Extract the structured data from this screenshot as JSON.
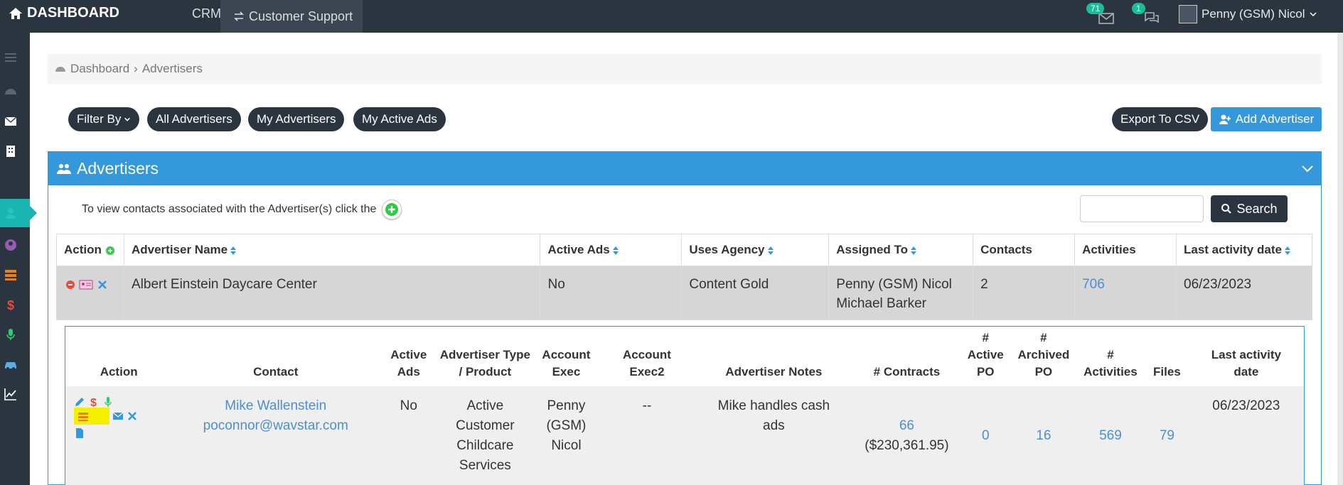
{
  "topbar": {
    "brand": "DASHBOARD",
    "nav_crm": "CRM",
    "nav_customer_support": "Customer Support",
    "mail_count": "71",
    "chat_count": "1",
    "user_name": "Penny (GSM) Nicol"
  },
  "breadcrumb": {
    "home": "Dashboard",
    "separator": "›",
    "current": "Advertisers"
  },
  "filters": {
    "filter_by": "Filter By",
    "all": "All Advertisers",
    "mine": "My Advertisers",
    "active_ads": "My Active Ads"
  },
  "actions": {
    "export": "Export To CSV",
    "add": "Add Advertiser"
  },
  "panel": {
    "title": "Advertisers",
    "hint": "To view contacts associated with the Advertiser(s) click the",
    "search_label": "Search"
  },
  "table": {
    "headers": {
      "action": "Action",
      "name": "Advertiser Name",
      "active_ads": "Active Ads",
      "uses_agency": "Uses Agency",
      "assigned": "Assigned To",
      "contacts": "Contacts",
      "activities": "Activities",
      "last_activity": "Last activity date"
    },
    "row": {
      "name": "Albert Einstein Daycare Center",
      "active_ads": "No",
      "uses_agency": "Content Gold",
      "assigned_1": "Penny (GSM) Nicol",
      "assigned_2": "Michael Barker",
      "contacts": "2",
      "activities": "706",
      "last_activity": "06/23/2023"
    }
  },
  "subtable": {
    "headers": {
      "action": "Action",
      "contact": "Contact",
      "active_ads_1": "Active",
      "active_ads_2": "Ads",
      "type_1": "Advertiser Type",
      "type_2": "/ Product",
      "exec_1": "Account",
      "exec_2": "Exec",
      "exec2_1": "Account",
      "exec2_2": "Exec2",
      "notes": "Advertiser Notes",
      "contracts": "# Contracts",
      "active_po_1": "#",
      "active_po_2": "Active",
      "active_po_3": "PO",
      "archived_po_1": "#",
      "archived_po_2": "Archived",
      "archived_po_3": "PO",
      "activities_1": "#",
      "activities_2": "Activities",
      "files": "Files",
      "last_1": "Last activity",
      "last_2": "date"
    },
    "row": {
      "contact_name": "Mike Wallenstein",
      "contact_email": "poconnor@wavstar.com",
      "active_ads": "No",
      "type_1": "Active",
      "type_2": "Customer",
      "type_3": "Childcare",
      "type_4": "Services",
      "exec_1": "Penny",
      "exec_2": "(GSM)",
      "exec_3": "Nicol",
      "exec2": "--",
      "notes_1": "Mike handles cash",
      "notes_2": "ads",
      "contracts": "66",
      "contracts_amount": "($230,361.95)",
      "active_po": "0",
      "archived_po": "16",
      "activities": "569",
      "files": "79",
      "last_activity": "06/23/2023"
    }
  },
  "colors": {
    "topbar": "#2b3540",
    "accent": "#3498db",
    "teal": "#19b5b0",
    "link": "#4b8fd0"
  }
}
